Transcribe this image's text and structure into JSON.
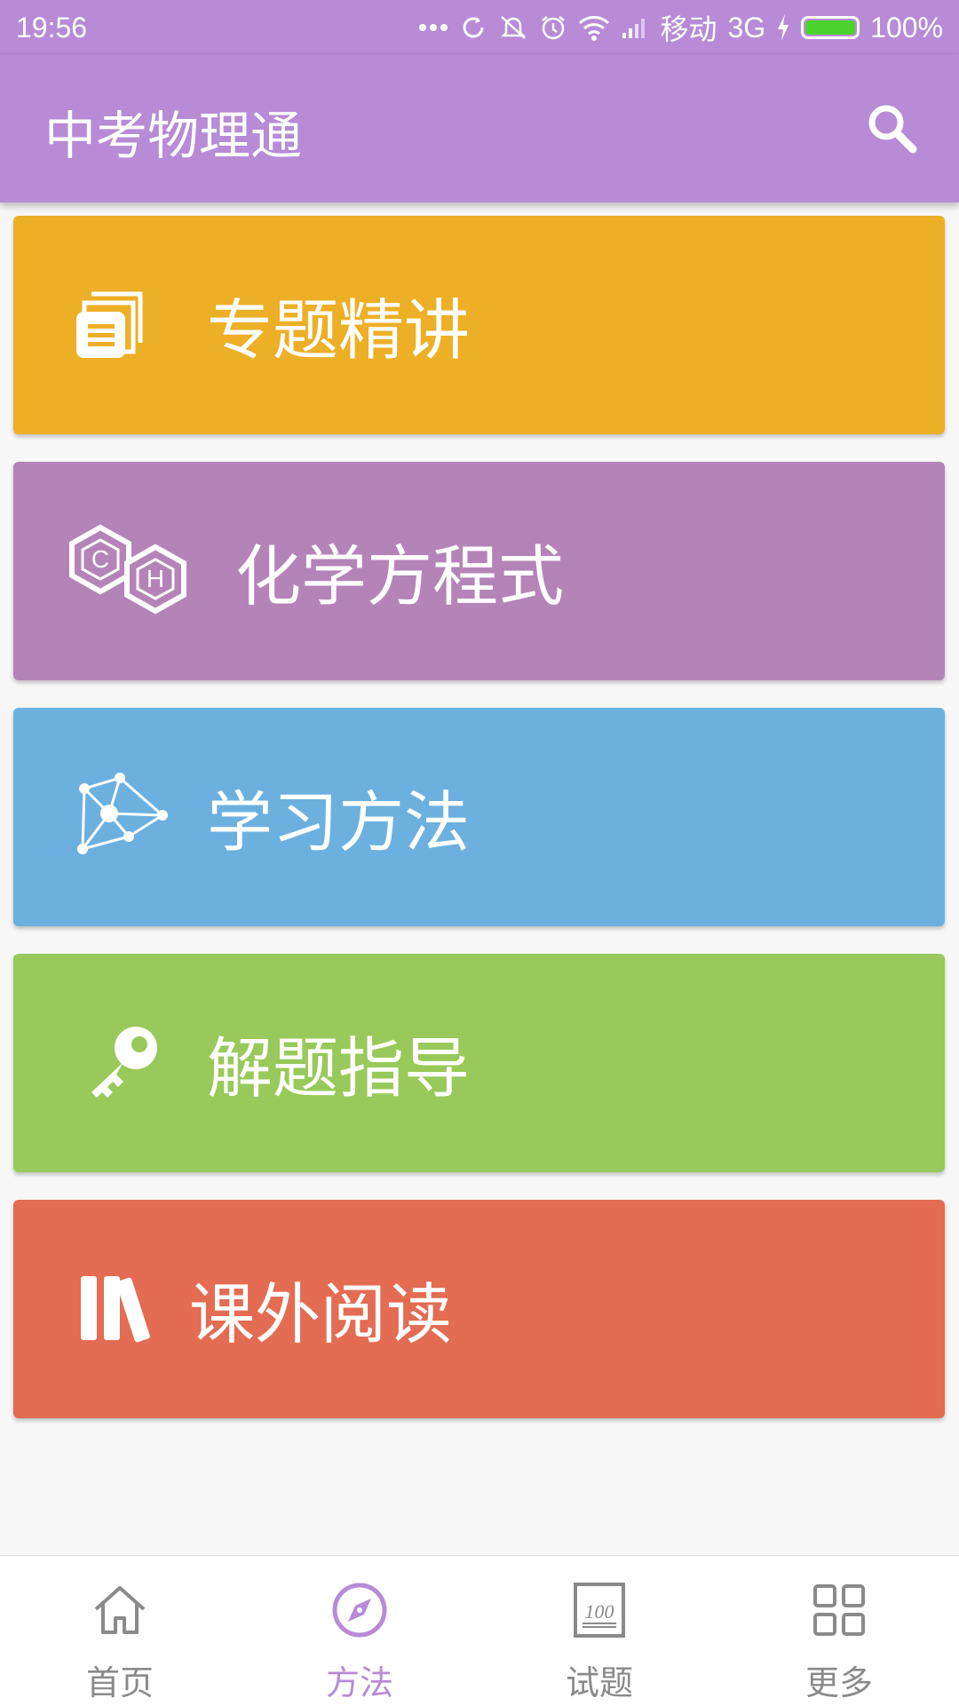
{
  "status_bar": {
    "time": "19:56",
    "carrier": "移动",
    "network": "3G",
    "battery_text": "100%",
    "battery_level": 1.0,
    "battery_color": "#4cd32d"
  },
  "app_bar": {
    "title": "中考物理通",
    "search_icon": "search-icon",
    "color": "#b78bd6"
  },
  "cards": [
    {
      "label": "专题精讲",
      "icon": "document-stack-icon",
      "color": "#edaf26"
    },
    {
      "label": "化学方程式",
      "icon": "chemistry-hexagon-icon",
      "color": "#b484b8"
    },
    {
      "label": "学习方法",
      "icon": "network-graph-icon",
      "color": "#6cb0e0"
    },
    {
      "label": "解题指导",
      "icon": "key-icon",
      "color": "#98c95a"
    },
    {
      "label": "课外阅读",
      "icon": "books-icon",
      "color": "#e36c52"
    }
  ],
  "bottom_nav": {
    "items": [
      {
        "label": "首页",
        "icon": "home-icon",
        "active": false
      },
      {
        "label": "方法",
        "icon": "compass-icon",
        "active": true
      },
      {
        "label": "试题",
        "icon": "exam-100-icon",
        "active": false
      },
      {
        "label": "更多",
        "icon": "grid-icon",
        "active": false
      }
    ],
    "active_color": "#b78bd6",
    "inactive_color": "#8a8a8a"
  }
}
